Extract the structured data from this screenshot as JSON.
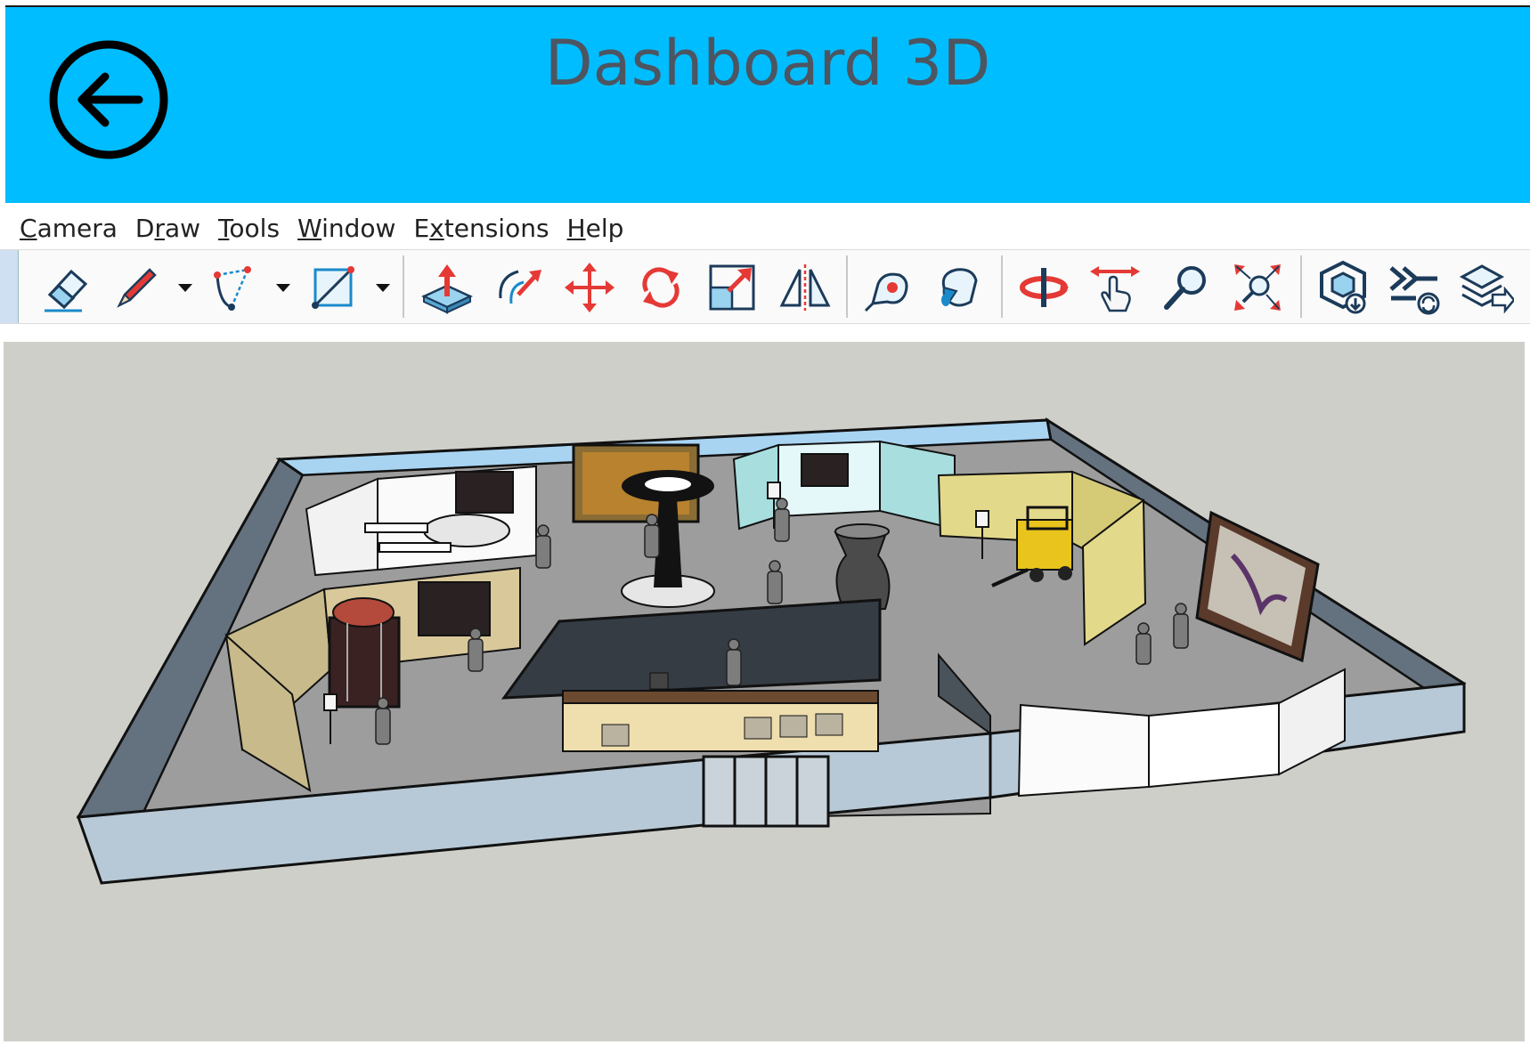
{
  "header": {
    "title": "Dashboard 3D",
    "background": "#00bdff",
    "back_icon": "arrow-left-circle-icon"
  },
  "menubar": {
    "items": [
      {
        "label_pre": "",
        "label_key": "C",
        "label_post": "amera"
      },
      {
        "label_pre": "D",
        "label_key": "r",
        "label_post": "aw"
      },
      {
        "label_pre": "",
        "label_key": "T",
        "label_post": "ools"
      },
      {
        "label_pre": "",
        "label_key": "W",
        "label_post": "indow"
      },
      {
        "label_pre": "E",
        "label_key": "x",
        "label_post": "tensions"
      },
      {
        "label_pre": "",
        "label_key": "H",
        "label_post": "elp"
      }
    ]
  },
  "toolbar": {
    "tools": [
      "eraser-icon",
      "pencil-line-icon",
      "arc-icon",
      "rectangle-icon",
      "push-pull-icon",
      "offset-icon",
      "move-icon",
      "rotate-icon",
      "scale-icon",
      "mirror-icon",
      "tape-measure-icon",
      "paint-bucket-icon",
      "orbit-icon",
      "pan-icon",
      "zoom-icon",
      "zoom-extents-icon",
      "warehouse-icon",
      "extension-manager-icon",
      "layers-export-icon"
    ]
  },
  "viewport": {
    "background": "#cfcfca",
    "floor_color": "#9b9b9b",
    "wall_color": "#b8c8d6"
  }
}
